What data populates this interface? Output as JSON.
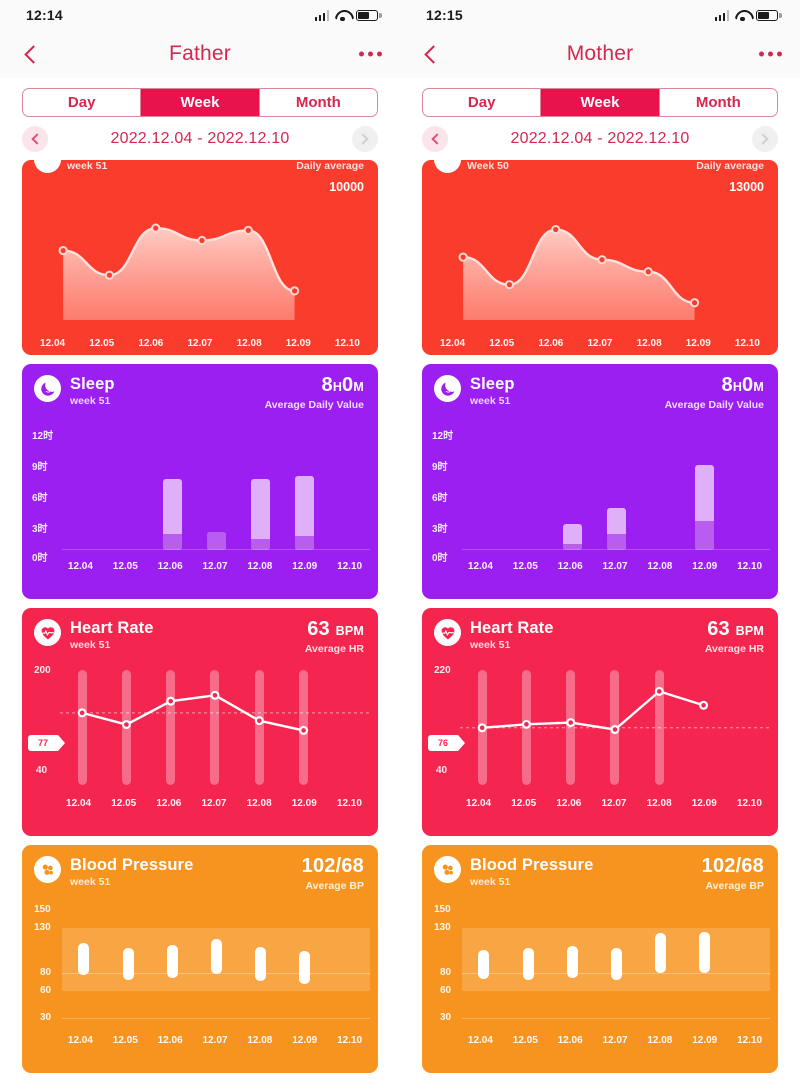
{
  "panels": [
    {
      "status": {
        "time": "12:14",
        "signal_icon": "signal-bars-icon",
        "wifi_icon": "wifi-icon",
        "battery_icon": "battery-icon"
      },
      "nav": {
        "back_icon": "back-chevron-icon",
        "title": "Father",
        "more_icon": "more-dots-icon"
      },
      "segmented": {
        "options": [
          "Day",
          "Week",
          "Month"
        ],
        "selected": "Week"
      },
      "date": {
        "prev_icon": "chevron-left-icon",
        "range": "2022.12.04 - 2022.12.10",
        "next_icon": "chevron-right-icon"
      },
      "cards": {
        "steps": {
          "week": "week 51",
          "unit_label": "Daily average",
          "max_label": "10000",
          "icon": "steps-icon",
          "color": "#fa3c2d",
          "x_labels": [
            "12.04",
            "12.05",
            "12.06",
            "12.07",
            "12.08",
            "12.09",
            "12.10"
          ]
        },
        "sleep": {
          "title": "Sleep",
          "week": "week 51",
          "value": "8",
          "value_unit_h": "H",
          "value_minutes": "0",
          "value_unit_m": "M",
          "unit_label": "Average Daily Value",
          "icon": "moon-face-icon",
          "color": "#9b1ff0",
          "y_labels": [
            "12时",
            "9时",
            "6时",
            "3时",
            "0时"
          ],
          "x_labels": [
            "12.04",
            "12.05",
            "12.06",
            "12.07",
            "12.08",
            "12.09",
            "12.10"
          ]
        },
        "heart_rate": {
          "title": "Heart Rate",
          "week": "week 51",
          "value": "63",
          "unit": "BPM",
          "unit_label": "Average HR",
          "icon": "heart-pulse-icon",
          "color": "#f4264f",
          "y_max_label": "200",
          "y_min_label": "40",
          "avg_tag": "77",
          "x_labels": [
            "12.04",
            "12.05",
            "12.06",
            "12.07",
            "12.08",
            "12.09",
            "12.10"
          ]
        },
        "blood_pressure": {
          "title": "Blood Pressure",
          "week": "week 51",
          "value": "102/68",
          "unit_label": "Average BP",
          "icon": "bp-cuff-icon",
          "color": "#f79420",
          "y_labels": [
            "150",
            "130",
            "80",
            "60",
            "30"
          ],
          "x_labels": [
            "12.04",
            "12.05",
            "12.06",
            "12.07",
            "12.08",
            "12.09",
            "12.10"
          ]
        }
      }
    },
    {
      "status": {
        "time": "12:15",
        "signal_icon": "signal-bars-icon",
        "wifi_icon": "wifi-icon",
        "battery_icon": "battery-icon"
      },
      "nav": {
        "back_icon": "back-chevron-icon",
        "title": "Mother",
        "more_icon": "more-dots-icon"
      },
      "segmented": {
        "options": [
          "Day",
          "Week",
          "Month"
        ],
        "selected": "Week"
      },
      "date": {
        "prev_icon": "chevron-left-icon",
        "range": "2022.12.04 - 2022.12.10",
        "next_icon": "chevron-right-icon"
      },
      "cards": {
        "steps": {
          "week": "Week 50",
          "unit_label": "Daily average",
          "max_label": "13000",
          "icon": "steps-icon",
          "color": "#fa3c2d",
          "x_labels": [
            "12.04",
            "12.05",
            "12.06",
            "12.07",
            "12.08",
            "12.09",
            "12.10"
          ]
        },
        "sleep": {
          "title": "Sleep",
          "week": "week 51",
          "value": "8",
          "value_unit_h": "H",
          "value_minutes": "0",
          "value_unit_m": "M",
          "unit_label": "Average Daily Value",
          "icon": "moon-face-icon",
          "color": "#9b1ff0",
          "y_labels": [
            "12时",
            "9时",
            "6时",
            "3时",
            "0时"
          ],
          "x_labels": [
            "12.04",
            "12.05",
            "12.06",
            "12.07",
            "12.08",
            "12.09",
            "12.10"
          ]
        },
        "heart_rate": {
          "title": "Heart Rate",
          "week": "week 51",
          "value": "63",
          "unit": "BPM",
          "unit_label": "Average HR",
          "icon": "heart-pulse-icon",
          "color": "#f4264f",
          "y_max_label": "220",
          "y_min_label": "40",
          "avg_tag": "76",
          "x_labels": [
            "12.04",
            "12.05",
            "12.06",
            "12.07",
            "12.08",
            "12.09",
            "12.10"
          ]
        },
        "blood_pressure": {
          "title": "Blood Pressure",
          "week": "week 51",
          "value": "102/68",
          "unit_label": "Average BP",
          "icon": "bp-cuff-icon",
          "color": "#f79420",
          "y_labels": [
            "150",
            "130",
            "80",
            "60",
            "30"
          ],
          "x_labels": [
            "12.04",
            "12.05",
            "12.06",
            "12.07",
            "12.08",
            "12.09",
            "12.10"
          ]
        }
      }
    }
  ],
  "chart_data": [
    {
      "panel": "Father",
      "type": "area",
      "title": "Steps",
      "ylabel": "steps",
      "ylim": [
        0,
        10000
      ],
      "x": [
        "12.04",
        "12.05",
        "12.06",
        "12.07",
        "12.08",
        "12.09",
        "12.10"
      ],
      "values": [
        6200,
        4000,
        8200,
        7100,
        8000,
        2600,
        null
      ],
      "annotation": "10000",
      "legend": "Daily average"
    },
    {
      "panel": "Father",
      "type": "bar",
      "title": "Sleep",
      "ylabel": "hours",
      "ylim": [
        0,
        12
      ],
      "yticks": [
        0,
        3,
        6,
        9,
        12
      ],
      "ytick_labels": [
        "0时",
        "3时",
        "6时",
        "9时",
        "12时"
      ],
      "categories": [
        "12.04",
        "12.05",
        "12.06",
        "12.07",
        "12.08",
        "12.09",
        "12.10"
      ],
      "series": [
        {
          "name": "total",
          "values": [
            0,
            0,
            6.7,
            1.7,
            6.7,
            7.0,
            0
          ]
        },
        {
          "name": "deep",
          "values": [
            0,
            0,
            1.5,
            1.7,
            1.0,
            1.3,
            0
          ]
        }
      ],
      "summary": "8H 0M Average Daily Value"
    },
    {
      "panel": "Father",
      "type": "line",
      "title": "Heart Rate",
      "ylabel": "BPM",
      "ylim": [
        40,
        200
      ],
      "categories": [
        "12.04",
        "12.05",
        "12.06",
        "12.07",
        "12.08",
        "12.09",
        "12.10"
      ],
      "series": [
        {
          "name": "average",
          "values": [
            77,
            71,
            83,
            86,
            73,
            68,
            null
          ]
        },
        {
          "name": "range_max",
          "values": [
            118,
            100,
            112,
            140,
            105,
            96,
            null
          ]
        },
        {
          "name": "range_min",
          "values": [
            48,
            48,
            48,
            48,
            48,
            48,
            null
          ]
        }
      ],
      "annotation": "77",
      "summary": "63 BPM Average HR"
    },
    {
      "panel": "Father",
      "type": "bar",
      "title": "Blood Pressure",
      "ylabel": "mmHg",
      "ylim": [
        30,
        150
      ],
      "yticks": [
        30,
        60,
        80,
        130,
        150
      ],
      "band": [
        60,
        130
      ],
      "categories": [
        "12.04",
        "12.05",
        "12.06",
        "12.07",
        "12.08",
        "12.09",
        "12.10"
      ],
      "series": [
        {
          "name": "systolic",
          "values": [
            113,
            108,
            111,
            118,
            109,
            104,
            null
          ]
        },
        {
          "name": "diastolic",
          "values": [
            78,
            72,
            74,
            79,
            71,
            68,
            null
          ]
        }
      ],
      "summary": "102/68 Average BP"
    },
    {
      "panel": "Mother",
      "type": "area",
      "title": "Steps",
      "ylabel": "steps",
      "ylim": [
        0,
        13000
      ],
      "x": [
        "12.04",
        "12.05",
        "12.06",
        "12.07",
        "12.08",
        "12.09",
        "12.10"
      ],
      "values": [
        7300,
        4100,
        10500,
        7000,
        5600,
        2000,
        null
      ],
      "annotation": "13000",
      "legend": "Daily average"
    },
    {
      "panel": "Mother",
      "type": "bar",
      "title": "Sleep",
      "ylabel": "hours",
      "ylim": [
        0,
        12
      ],
      "yticks": [
        0,
        3,
        6,
        9,
        12
      ],
      "ytick_labels": [
        "0时",
        "3时",
        "6时",
        "9时",
        "12时"
      ],
      "categories": [
        "12.04",
        "12.05",
        "12.06",
        "12.07",
        "12.08",
        "12.09",
        "12.10"
      ],
      "series": [
        {
          "name": "total",
          "values": [
            0,
            0,
            2.5,
            4.0,
            0,
            8.0,
            0
          ]
        },
        {
          "name": "deep",
          "values": [
            0,
            0,
            0.6,
            1.5,
            0,
            2.7,
            0
          ]
        }
      ],
      "summary": "8H 0M Average Daily Value"
    },
    {
      "panel": "Mother",
      "type": "line",
      "title": "Heart Rate",
      "ylabel": "BPM",
      "ylim": [
        40,
        220
      ],
      "categories": [
        "12.04",
        "12.05",
        "12.06",
        "12.07",
        "12.08",
        "12.09",
        "12.10"
      ],
      "series": [
        {
          "name": "average",
          "values": [
            73,
            75,
            76,
            72,
            94,
            86,
            null
          ]
        },
        {
          "name": "range_max",
          "values": [
            150,
            108,
            106,
            128,
            160,
            null,
            null
          ]
        },
        {
          "name": "range_min",
          "values": [
            48,
            52,
            52,
            48,
            70,
            null,
            null
          ]
        }
      ],
      "annotation": "76",
      "summary": "63 BPM Average HR"
    },
    {
      "panel": "Mother",
      "type": "bar",
      "title": "Blood Pressure",
      "ylabel": "mmHg",
      "ylim": [
        30,
        150
      ],
      "yticks": [
        30,
        60,
        80,
        130,
        150
      ],
      "band": [
        60,
        130
      ],
      "categories": [
        "12.04",
        "12.05",
        "12.06",
        "12.07",
        "12.08",
        "12.09",
        "12.10"
      ],
      "series": [
        {
          "name": "systolic",
          "values": [
            106,
            108,
            110,
            108,
            124,
            126,
            null
          ]
        },
        {
          "name": "diastolic",
          "values": [
            73,
            72,
            74,
            72,
            80,
            80,
            null
          ]
        }
      ],
      "summary": "102/68 Average BP"
    }
  ]
}
